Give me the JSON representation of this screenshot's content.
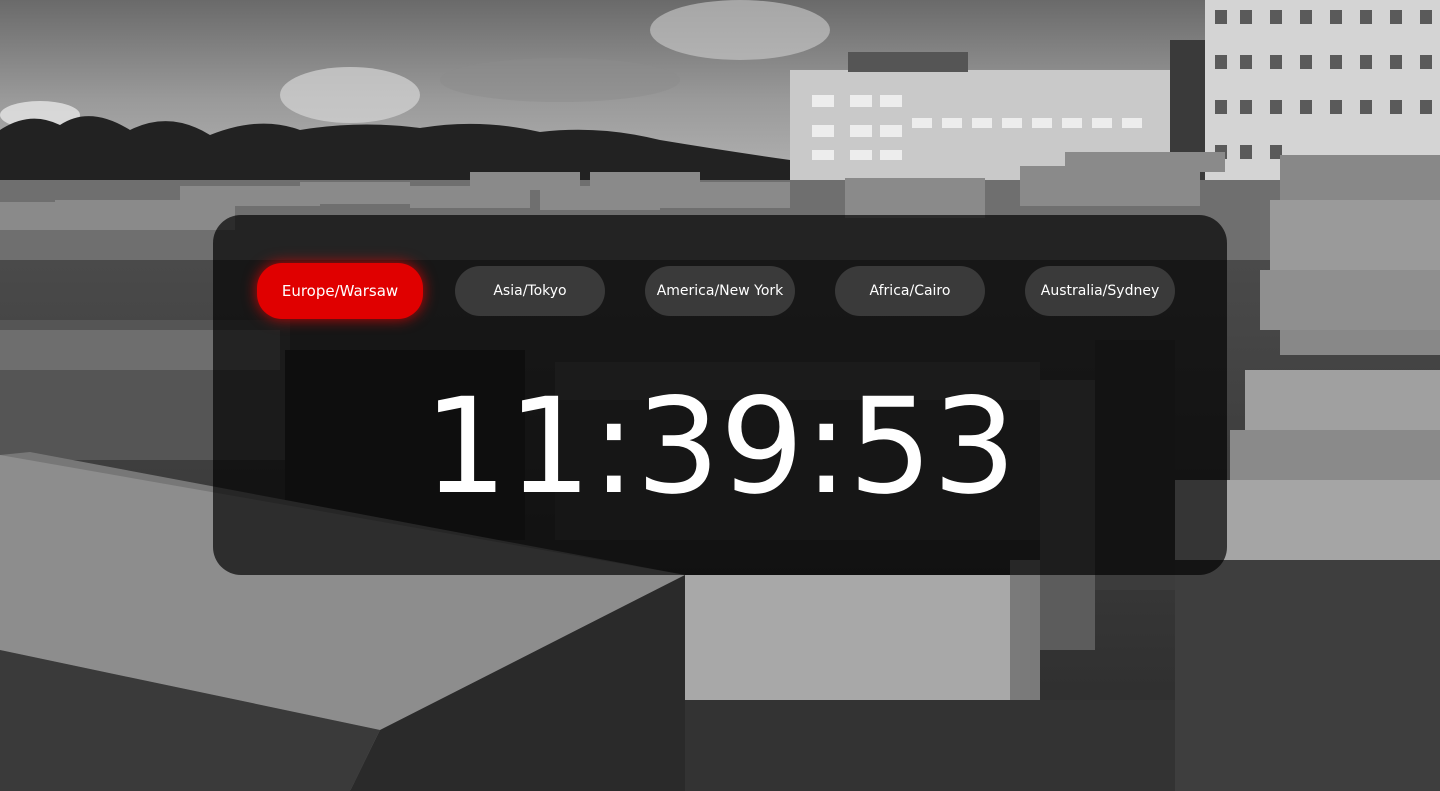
{
  "clock": {
    "timezones": [
      {
        "label": "Europe/Warsaw",
        "active": true
      },
      {
        "label": "Asia/Tokyo",
        "active": false
      },
      {
        "label": "America/New York",
        "active": false
      },
      {
        "label": "Africa/Cairo",
        "active": false
      },
      {
        "label": "Australia/Sydney",
        "active": false
      }
    ],
    "time": "11:39:53",
    "accent_color": "#e00000"
  },
  "background": {
    "style": "black-and-white photograph of concrete stelae field with buildings and trees under cloudy sky"
  }
}
